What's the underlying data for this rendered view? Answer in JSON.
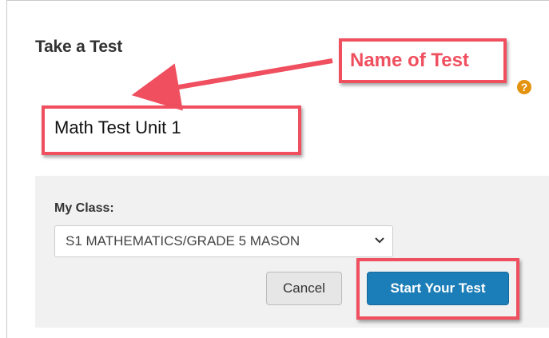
{
  "page": {
    "title": "Take a Test",
    "help_icon_glyph": "?",
    "test_name": "Math Test Unit 1"
  },
  "annotation": {
    "label": "Name of Test",
    "color": "#ef4f5e"
  },
  "form": {
    "class_label": "My Class:",
    "class_selected": "S1 MATHEMATICS/GRADE 5 MASON",
    "chevron_glyph": "⌄",
    "cancel_label": "Cancel",
    "start_label": "Start Your Test"
  },
  "colors": {
    "primary_button": "#1c7eb8",
    "help_icon": "#e3930f",
    "panel_background": "#f1f1f1"
  },
  "icons": {
    "help": "help-icon",
    "dropdown": "chevron-down-icon",
    "annotation_arrow": "arrow-icon"
  }
}
